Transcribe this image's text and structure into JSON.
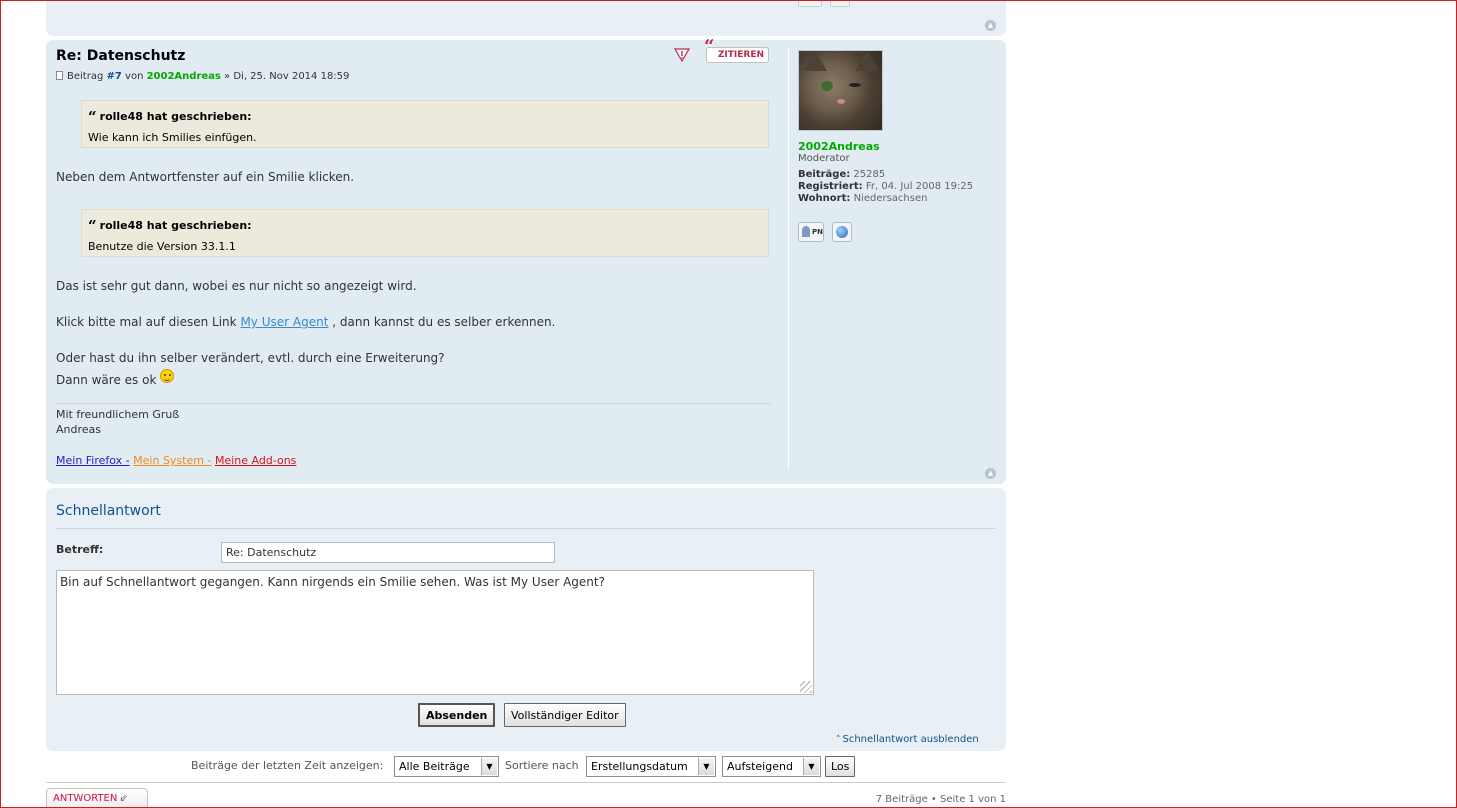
{
  "post": {
    "title": "Re: Datenschutz",
    "quote_label": "ZITIEREN",
    "author_prefix": "Beitrag",
    "post_number": "#7",
    "by": "von",
    "author": "2002Andreas",
    "date": "» Di, 25. Nov 2014 18:59",
    "quotes": [
      {
        "cite": "rolle48 hat geschrieben:",
        "text": "Wie kann ich Smilies einfügen."
      },
      {
        "cite": "rolle48 hat geschrieben:",
        "text": "Benutze die Version 33.1.1"
      }
    ],
    "para1": "Neben dem Antwortfenster auf ein Smilie klicken.",
    "para2": "Das ist sehr gut dann, wobei es nur nicht so angezeigt wird.",
    "para3_before": "Klick bitte mal auf diesen Link",
    "para3_link": "My User Agent",
    "para3_after": ", dann kannst du es selber erkennen.",
    "para4": "Oder hast du ihn selber verändert, evtl. durch eine Erweiterung?",
    "para5": "Dann wäre es ok",
    "sig_line1": "Mit freundlichem Gruß",
    "sig_line2": "Andreas",
    "sig_links": [
      {
        "label": "Mein Firefox -",
        "color": "#2321c3"
      },
      {
        "label": "Mein System -",
        "color": "#ef8a1c"
      },
      {
        "label": "Meine Add-ons",
        "color": "#d3141a"
      }
    ]
  },
  "profile": {
    "name": "2002Andreas",
    "rank": "Moderator",
    "posts_label": "Beiträge:",
    "posts_value": "25285",
    "registered_label": "Registriert:",
    "registered_value": "Fr, 04. Jul 2008 19:25",
    "location_label": "Wohnort:",
    "location_value": "Niedersachsen",
    "pm_label": "PN"
  },
  "quick_reply": {
    "title": "Schnellantwort",
    "subject_label": "Betreff:",
    "subject_value": "Re: Datenschutz",
    "message": "Bin auf Schnellantwort gegangen. Kann nirgends ein Smilie sehen. Was ist My User Agent?",
    "submit_label": "Absenden",
    "full_editor_label": "Vollständiger Editor",
    "hide_label": "Schnellantwort ausblenden"
  },
  "sort_bar": {
    "show_label": "Beiträge der letzten Zeit anzeigen:",
    "show_value": "Alle Beiträge",
    "sort_label": "Sortiere nach",
    "sort_value": "Erstellungsdatum",
    "order_value": "Aufsteigend",
    "go_label": "Los"
  },
  "footer": {
    "answer_label": "ANTWORTEN",
    "page_info": "7 Beiträge • Seite 1 von 1"
  },
  "colors": {
    "post_bg": "#e1ebf2",
    "panel_bg": "#e9f0f5",
    "username": "#00aa00",
    "link": "#105289",
    "accent_red": "#bc2a4d"
  }
}
